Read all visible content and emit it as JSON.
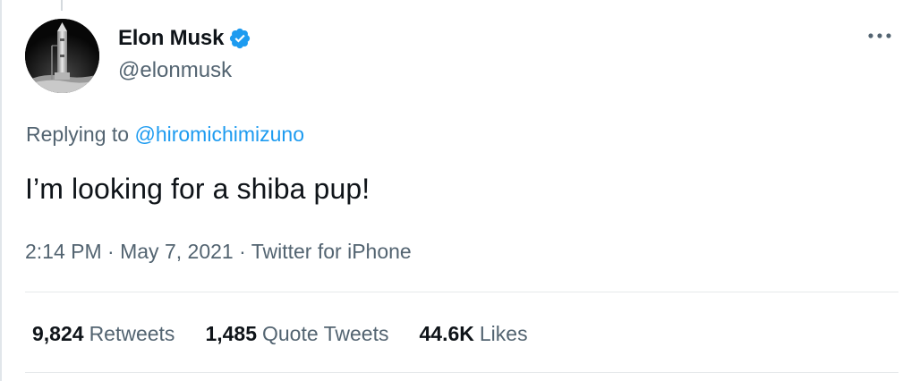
{
  "author": {
    "name": "Elon Musk",
    "handle": "@elonmusk",
    "verified_color": "#1d9bf0",
    "avatar": "rocket-on-launchpad-photo"
  },
  "reply": {
    "prefix": "Replying to",
    "mention": "@hiromichimizuno"
  },
  "tweet": {
    "text": "I’m looking for a shiba pup!"
  },
  "meta": {
    "time": "2:14 PM",
    "separator": "·",
    "date": "May 7, 2021",
    "source": "Twitter for iPhone"
  },
  "stats": [
    {
      "value": "9,824",
      "label": "Retweets"
    },
    {
      "value": "1,485",
      "label": "Quote Tweets"
    },
    {
      "value": "44.6K",
      "label": "Likes"
    }
  ],
  "icons": {
    "more": "more-horizontal-icon",
    "verified": "verified-badge-icon"
  },
  "colors": {
    "text_primary": "#0f1419",
    "text_secondary": "#536471",
    "link": "#1d9bf0",
    "divider": "#e6e9eb"
  }
}
